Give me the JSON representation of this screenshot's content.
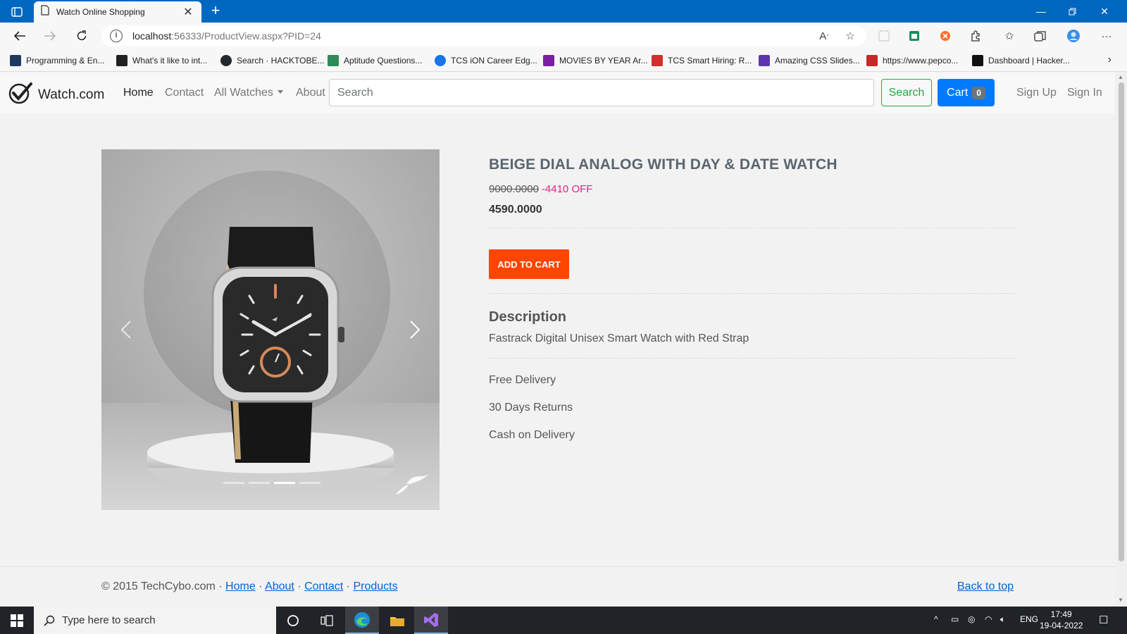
{
  "browser": {
    "tab_title": "Watch Online Shopping",
    "url_host": "localhost",
    "url_rest": ":56333/ProductView.aspx?PID=24",
    "bookmarks": [
      {
        "label": "Programming & En...",
        "color": "#1e3a5f"
      },
      {
        "label": "What's it like to int...",
        "color": "#222222"
      },
      {
        "label": "Search · HACKTOBE...",
        "color": "#24292e"
      },
      {
        "label": "Aptitude Questions...",
        "color": "#2e8b57"
      },
      {
        "label": "TCS iON Career Edg...",
        "color": "#1a73e8"
      },
      {
        "label": "MOVIES BY YEAR Ar...",
        "color": "#7b1fa2"
      },
      {
        "label": "TCS Smart Hiring: R...",
        "color": "#d32f2f"
      },
      {
        "label": "Amazing CSS Slides...",
        "color": "#5e35b1"
      },
      {
        "label": "https://www.pepco...",
        "color": "#c62828"
      },
      {
        "label": "Dashboard | Hacker...",
        "color": "#111111"
      }
    ]
  },
  "site": {
    "brand": "Watch.com",
    "nav": {
      "home": "Home",
      "contact": "Contact",
      "all_watches": "All Watches",
      "about": "About"
    },
    "search_placeholder": "Search",
    "search_button": "Search",
    "cart_label": "Cart",
    "cart_count": "0",
    "sign_up": "Sign Up",
    "sign_in": "Sign In"
  },
  "product": {
    "title": "BEIGE DIAL ANALOG WITH DAY & DATE WATCH",
    "old_price": "9000.0000",
    "discount": "-4410 OFF",
    "price": "4590.0000",
    "add_to_cart": "ADD TO CART",
    "description_heading": "Description",
    "description": "Fastrack Digital Unisex Smart Watch with Red Strap",
    "features": [
      "Free Delivery",
      "30 Days Returns",
      "Cash on Delivery"
    ],
    "carousel": {
      "slide_count": 4,
      "active_index": 2
    }
  },
  "footer": {
    "copyright": "© 2015 TechCybo.com",
    "links": [
      "Home",
      "About",
      "Contact",
      "Products"
    ],
    "back_to_top": "Back to top"
  },
  "taskbar": {
    "search_placeholder": "Type here to search",
    "language": "ENG",
    "time": "17:49",
    "date": "19-04-2022"
  },
  "colors": {
    "titlebar": "#0067c0",
    "primary": "#007bff",
    "success": "#28a745",
    "add_to_cart": "#ff4500",
    "discount": "#e0218a"
  }
}
